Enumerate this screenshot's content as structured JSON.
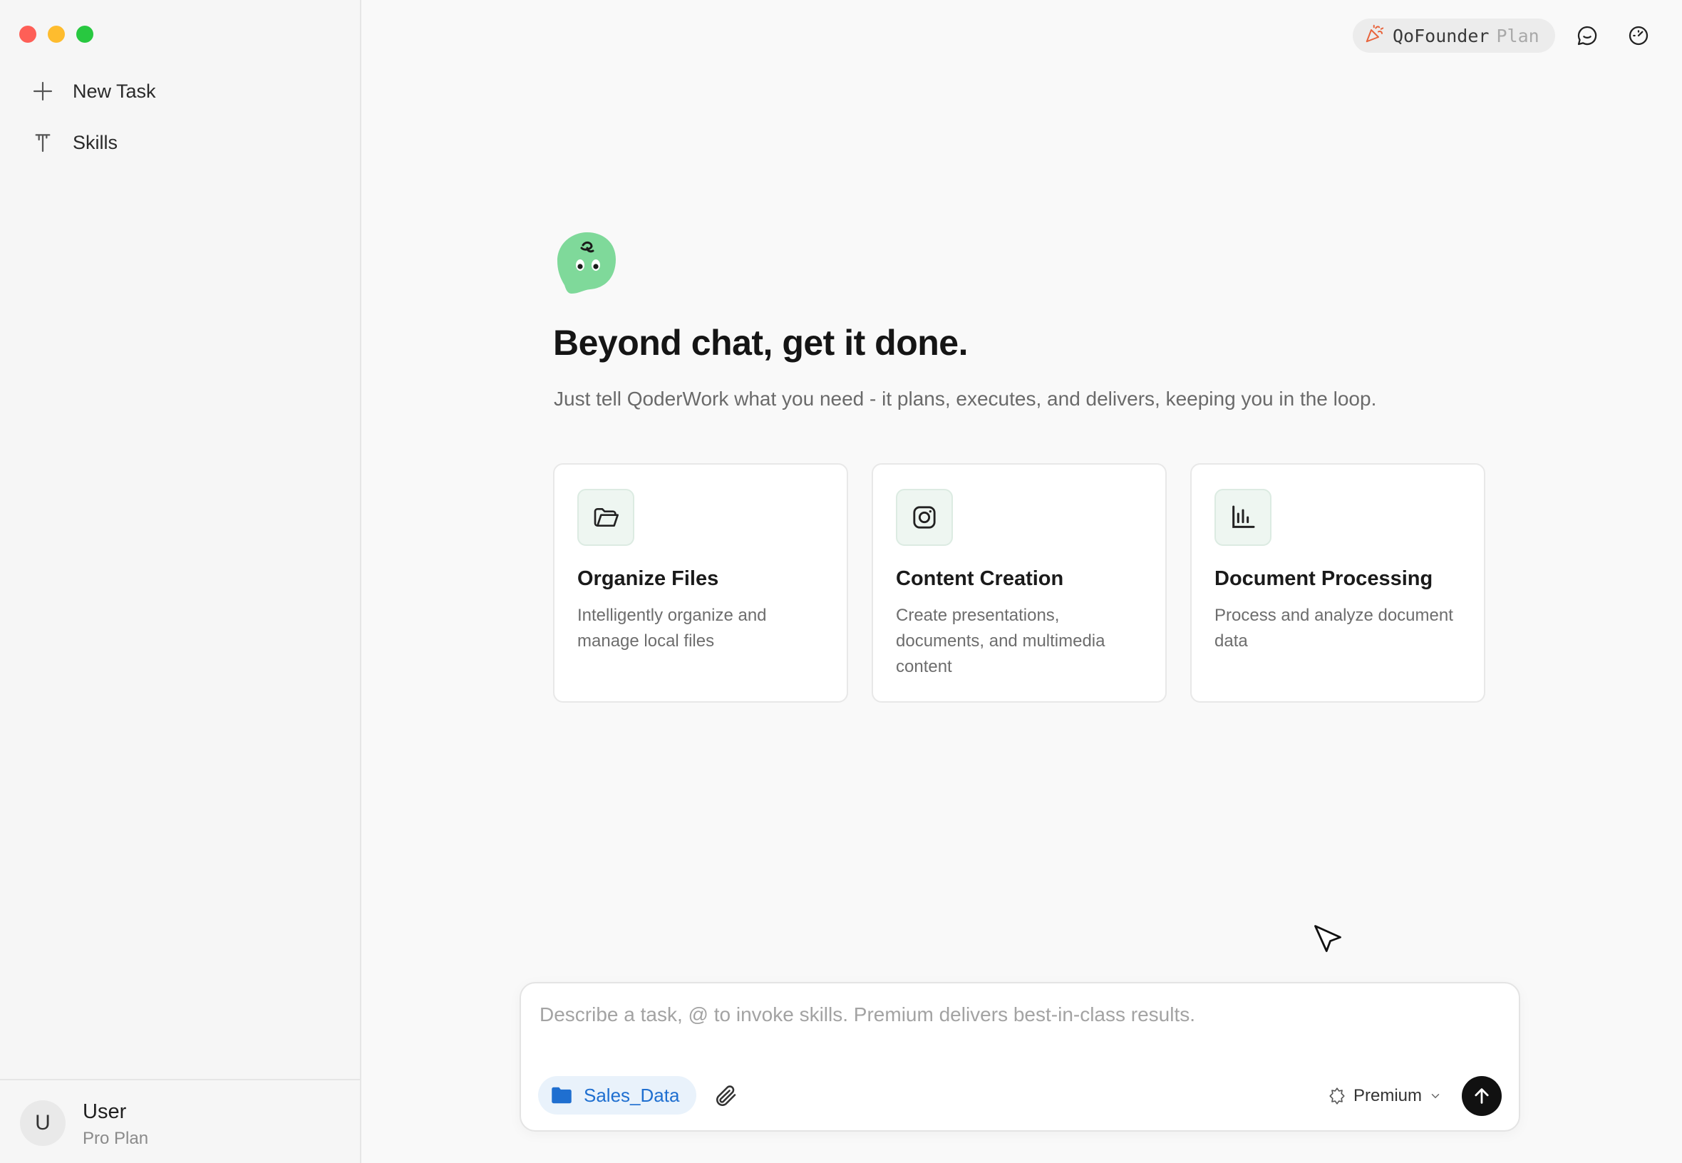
{
  "sidebar": {
    "items": [
      {
        "label": "New Task",
        "icon": "plus-icon"
      },
      {
        "label": "Skills",
        "icon": "skills-icon"
      }
    ],
    "user": {
      "initial": "U",
      "name": "User",
      "plan": "Pro Plan"
    }
  },
  "topbar": {
    "plan_pill": {
      "name": "QoFounder",
      "suffix": "Plan",
      "icon": "party-popper-icon"
    },
    "icons": [
      "chat-bubble-icon",
      "speedometer-icon"
    ]
  },
  "hero": {
    "headline": "Beyond chat, get it done.",
    "subline": "Just tell QoderWork what you need - it plans, executes, and delivers, keeping you in the loop."
  },
  "cards": [
    {
      "title": "Organize Files",
      "desc": "Intelligently organize and manage local files",
      "icon": "folder-open-icon"
    },
    {
      "title": "Content Creation",
      "desc": "Create presentations, documents, and multimedia content",
      "icon": "instagram-icon"
    },
    {
      "title": "Document Processing",
      "desc": "Process and analyze document data",
      "icon": "bar-chart-icon"
    }
  ],
  "composer": {
    "placeholder": "Describe a task, @ to invoke skills. Premium delivers best-in-class results.",
    "value": "",
    "folder": "Sales_Data",
    "model": "Premium"
  },
  "colors": {
    "accent_green": "#7fd99a",
    "folder_blue": "#1f6fd0",
    "send": "#111111"
  }
}
